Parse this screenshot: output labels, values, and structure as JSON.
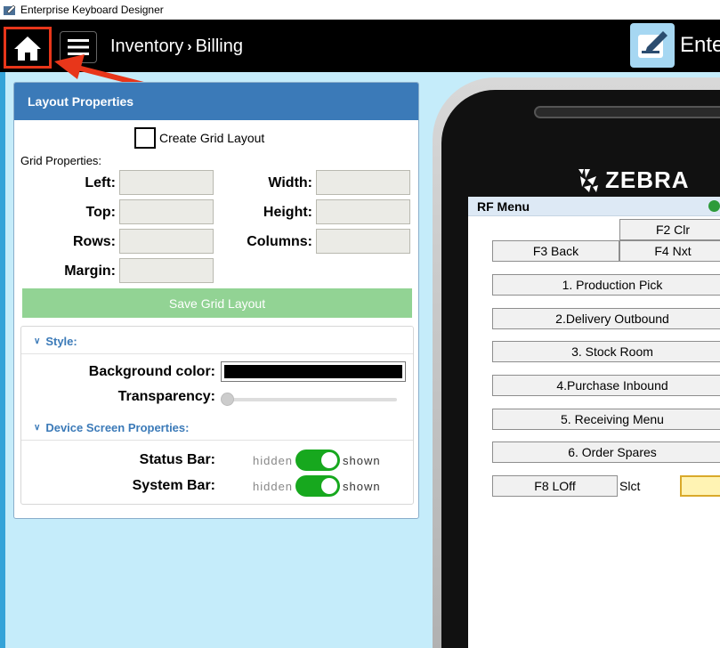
{
  "window": {
    "title": "Enterprise Keyboard Designer"
  },
  "topbar": {
    "breadcrumb_root": "Inventory",
    "breadcrumb_sep": "›",
    "breadcrumb_current": "Billing",
    "brand_text": "Ente",
    "accent": "#e8361a"
  },
  "layout_panel": {
    "title": "Layout Properties",
    "create_grid_label": "Create Grid Layout",
    "create_grid_checked": false,
    "grid_props_label": "Grid Properties:",
    "fields": {
      "left": "Left:",
      "width": "Width:",
      "top": "Top:",
      "height": "Height:",
      "rows": "Rows:",
      "columns": "Columns:",
      "margin": "Margin:"
    },
    "save_label": "Save Grid Layout"
  },
  "style_section": {
    "title": "Style:",
    "bg_color_label": "Background color:",
    "bg_color": "#000000",
    "transparency_label": "Transparency:",
    "transparency": 0
  },
  "device_section": {
    "title": "Device Screen Properties:",
    "status_bar_label": "Status Bar:",
    "system_bar_label": "System Bar:",
    "off_label": "hidden",
    "on_label": "shown",
    "status_bar_shown": true,
    "system_bar_shown": true
  },
  "device": {
    "brand": "ZEBRA",
    "screen_title": "RF Menu",
    "keys": {
      "f2": "F2 Clr",
      "f3": "F3 Back",
      "f4": "F4 Nxt",
      "m1": "1. Production Pick",
      "m2": "2.Delivery Outbound",
      "m3": "3. Stock Room",
      "m4": "4.Purchase Inbound",
      "m5": "5. Receiving Menu",
      "m6": "6. Order Spares",
      "f8": "F8 LOff"
    },
    "slct_label": "Slct"
  }
}
